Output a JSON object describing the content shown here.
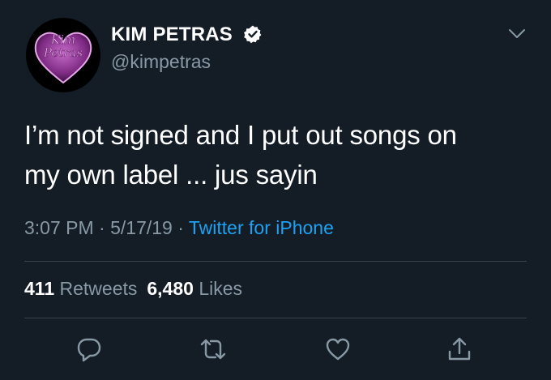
{
  "user": {
    "display_name": "KIM PETRAS",
    "handle": "@kimpetras",
    "verified": true,
    "avatar_text_top": "Kim",
    "avatar_text_bottom": "Petras"
  },
  "tweet": {
    "text_line_1": "I’m not signed and I put out songs on",
    "text_line_2": "my own label ... jus sayin",
    "time": "3:07 PM",
    "sep": "·",
    "date": "5/17/19",
    "source": "Twitter for iPhone"
  },
  "stats": {
    "retweets_count": "411",
    "retweets_label": "Retweets",
    "likes_count": "6,480",
    "likes_label": "Likes"
  },
  "colors": {
    "background": "#141d26",
    "secondary_text": "#8899a6",
    "link": "#1da1f2",
    "divider": "#38444d",
    "verified": "#ffffff"
  },
  "icons": [
    "chevron-down-icon",
    "verified-badge-icon",
    "reply-icon",
    "retweet-icon",
    "like-icon",
    "share-icon"
  ]
}
